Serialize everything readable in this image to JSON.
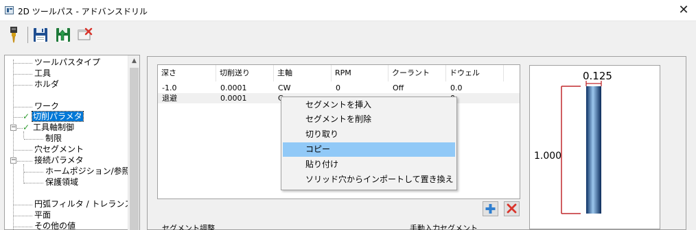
{
  "window": {
    "title": "2D ツールパス - アドバンスドリル",
    "close_glyph": "✕"
  },
  "toolbar": {
    "icons": [
      "drill-tool-icon",
      "save-icon",
      "save-and-calculate-icon",
      "cancel-icon"
    ]
  },
  "tree": {
    "items": [
      {
        "label": "ツールパスタイプ",
        "checked": false,
        "selected": false
      },
      {
        "label": "工具",
        "checked": false,
        "selected": false
      },
      {
        "label": "ホルダ",
        "checked": false,
        "selected": false
      },
      {
        "label": "ワーク",
        "checked": false,
        "selected": false
      },
      {
        "label": "切削パラメタ",
        "checked": true,
        "selected": true
      },
      {
        "label": "工具軸制御",
        "checked": true,
        "selected": false,
        "expander": "−"
      },
      {
        "label": "制限",
        "checked": false,
        "selected": false
      },
      {
        "label": "穴セグメント",
        "checked": false,
        "selected": false
      },
      {
        "label": "接続パラメタ",
        "checked": false,
        "selected": false,
        "expander": "−"
      },
      {
        "label": "ホームポジション/参照点",
        "checked": false,
        "selected": false
      },
      {
        "label": "保護領域",
        "checked": false,
        "selected": false
      },
      {
        "label": "円弧フィルタ / トレランス",
        "checked": false,
        "selected": false
      },
      {
        "label": "平面",
        "checked": false,
        "selected": false
      },
      {
        "label": "その他の値",
        "checked": false,
        "selected": false
      }
    ],
    "check_glyph": "✓",
    "scroll_up_glyph": "▲"
  },
  "segment_grid": {
    "columns": [
      "深さ",
      "切削送り",
      "主軸",
      "RPM",
      "クーラント",
      "ドウェル"
    ],
    "rows": [
      [
        "-1.0",
        "0.0001",
        "CW",
        "0",
        "Off",
        "0.0"
      ],
      [
        "退避",
        "0.0001",
        "C",
        "",
        "",
        "0"
      ]
    ]
  },
  "context_menu": {
    "items": [
      {
        "label": "セグメントを挿入",
        "active": false
      },
      {
        "label": "セグメントを削除",
        "active": false
      },
      {
        "label": "切り取り",
        "active": false
      },
      {
        "label": "コピー",
        "active": true
      },
      {
        "label": "貼り付け",
        "active": false
      },
      {
        "label": "ソリッド穴からインポートして置き換え",
        "active": false
      }
    ]
  },
  "preview": {
    "diameter_label": "0.125",
    "depth_label": "1.000"
  },
  "bottom": {
    "left_label": "セグメント調整",
    "right_label": "手動入力セグメント"
  },
  "colors": {
    "selection": "#0078d7",
    "menu_highlight": "#91c9f7",
    "check": "#2e9b2e",
    "dimension": "#c0282d"
  }
}
